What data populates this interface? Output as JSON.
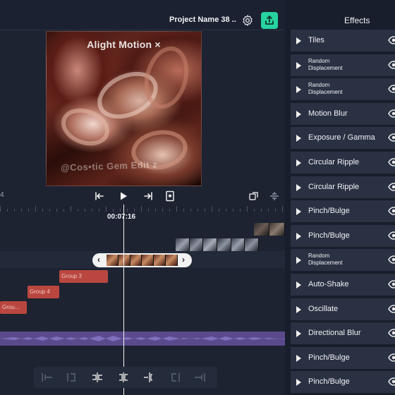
{
  "header": {
    "project_name": "Project Name 38 ..",
    "settings_icon": "gear-icon",
    "share_icon": "share-icon"
  },
  "preview": {
    "watermark": "Alight Motion ×",
    "overlay_text": "@Cos•tic Gem Edit z"
  },
  "transport": {
    "left_time_fragment": "4",
    "timecode": "00:07:16",
    "buttons": [
      "skip-to-start-icon",
      "play-icon",
      "skip-to-end-icon",
      "bookmark-icon"
    ],
    "right_buttons": [
      "loop-icon",
      "align-icon"
    ]
  },
  "timeline": {
    "groups": [
      "Group 3",
      "Group 4",
      "Grou..."
    ]
  },
  "effects": {
    "title": "Effects",
    "items": [
      {
        "label": "Tiles"
      },
      {
        "label": "Random Displacement"
      },
      {
        "label": "Random Displacement"
      },
      {
        "label": "Motion Blur"
      },
      {
        "label": "Exposure / Gamma"
      },
      {
        "label": "Circular Ripple"
      },
      {
        "label": "Circular Ripple"
      },
      {
        "label": "Pinch/Bulge"
      },
      {
        "label": "Pinch/Bulge"
      },
      {
        "label": "Random Displacement"
      },
      {
        "label": "Auto-Shake"
      },
      {
        "label": "Oscillate"
      },
      {
        "label": "Directional Blur"
      },
      {
        "label": "Pinch/Bulge"
      },
      {
        "label": "Pinch/Bulge"
      }
    ]
  },
  "colors": {
    "accent": "#27d3a0",
    "group_clip": "#b9473f",
    "audio_track": "#5a4a8c",
    "panel_bg": "#181e2b",
    "item_bg": "#2a3142"
  }
}
